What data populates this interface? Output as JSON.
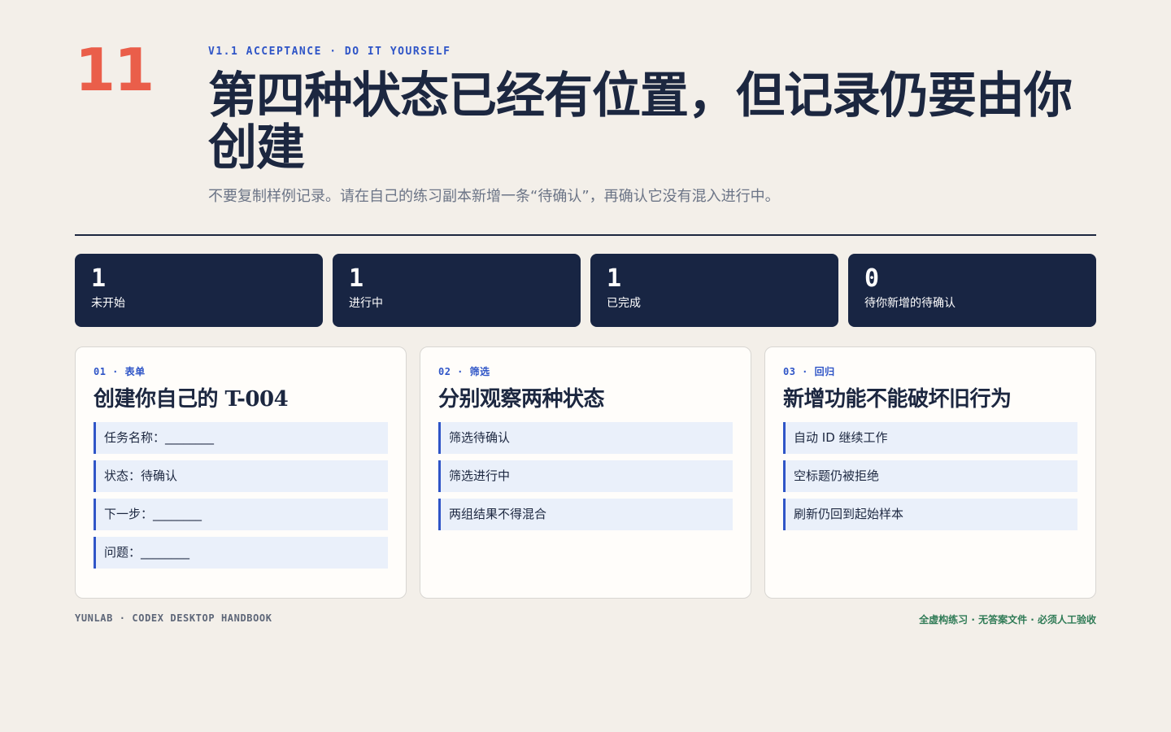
{
  "page_number": "11",
  "header": {
    "eyebrow": "V1.1 ACCEPTANCE · DO IT YOURSELF",
    "title": "第四种状态已经有位置，但记录仍要由你创建",
    "subtitle": "不要复制样例记录。请在自己的练习副本新增一条“待确认”，再确认它没有混入进行中。"
  },
  "stats": [
    {
      "value": "1",
      "label": "未开始"
    },
    {
      "value": "1",
      "label": "进行中"
    },
    {
      "value": "1",
      "label": "已完成"
    },
    {
      "value": "0",
      "label": "待你新增的待确认"
    }
  ],
  "cards": [
    {
      "eyebrow": "01 · 表单",
      "title": "创建你自己的 T-004",
      "items": [
        "任务名称：________",
        "状态：待确认",
        "下一步：________",
        "问题：________"
      ]
    },
    {
      "eyebrow": "02 · 筛选",
      "title": "分别观察两种状态",
      "items": [
        "筛选待确认",
        "筛选进行中",
        "两组结果不得混合"
      ]
    },
    {
      "eyebrow": "03 · 回归",
      "title": "新增功能不能破坏旧行为",
      "items": [
        "自动 ID 继续工作",
        "空标题仍被拒绝",
        "刷新仍回到起始样本"
      ]
    }
  ],
  "footer": {
    "left": "YUNLAB · CODEX DESKTOP HANDBOOK",
    "right": "全虚构练习 · 无答案文件 · 必须人工验收"
  }
}
